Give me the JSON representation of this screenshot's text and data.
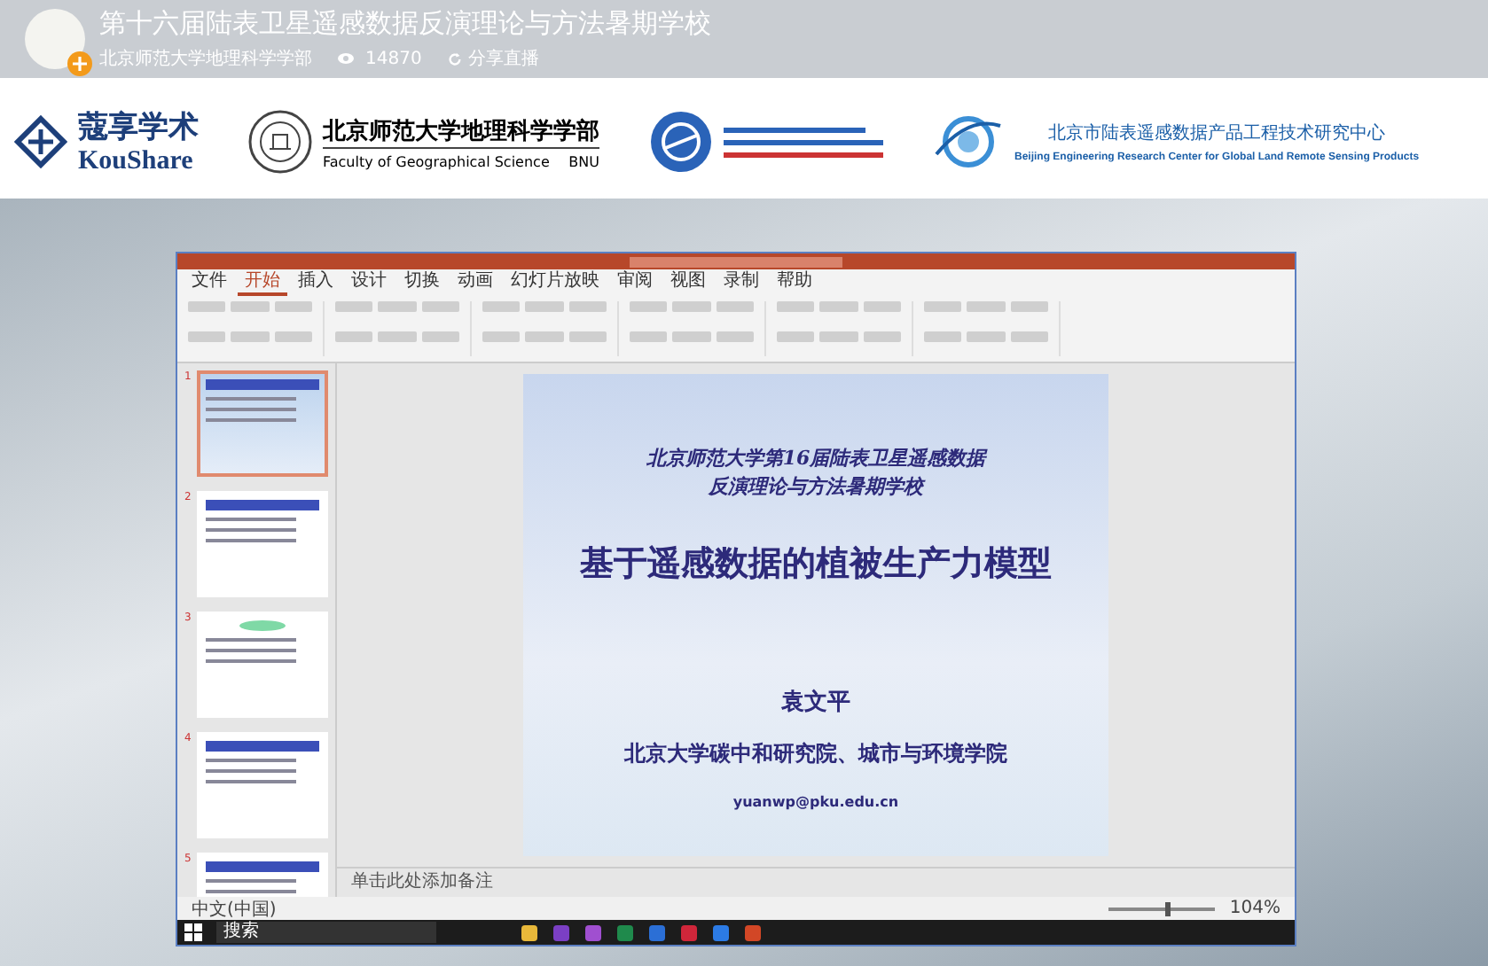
{
  "header": {
    "title": "第十六届陆表卫星遥感数据反演理论与方法暑期学校",
    "organizer": "北京师范大学地理科学学部",
    "views": "14870",
    "share": "分享直播"
  },
  "logos": {
    "koushare_cn": "蔻享学术",
    "koushare_en": "KouShare",
    "faculty_cn": "北京师范大学地理科学学部",
    "faculty_en": "Faculty of Geographical Science",
    "faculty_abbr": "BNU",
    "center_cn": "北京市陆表遥感数据产品工程技术研究中心",
    "center_en": "Beijing Engineering Research Center for Global Land Remote Sensing Products"
  },
  "ppt": {
    "tabs": [
      {
        "label": "文件",
        "selected": false
      },
      {
        "label": "开始",
        "selected": true
      },
      {
        "label": "插入",
        "selected": false
      },
      {
        "label": "设计",
        "selected": false
      },
      {
        "label": "切换",
        "selected": false
      },
      {
        "label": "动画",
        "selected": false
      },
      {
        "label": "幻灯片放映",
        "selected": false
      },
      {
        "label": "审阅",
        "selected": false
      },
      {
        "label": "视图",
        "selected": false
      },
      {
        "label": "录制",
        "selected": false
      },
      {
        "label": "帮助",
        "selected": false
      }
    ],
    "thumbnails": [
      {
        "number": "1",
        "selected": true
      },
      {
        "number": "2",
        "selected": false
      },
      {
        "number": "3",
        "selected": false
      },
      {
        "number": "4",
        "selected": false
      },
      {
        "number": "5",
        "selected": false
      }
    ],
    "slide": {
      "school": "北京师范大学第16届陆表卫星遥感数据反演理论与方法暑期学校",
      "title": "基于遥感数据的植被生产力模型",
      "author": "袁文平",
      "affiliation": "北京大学碳中和研究院、城市与环境学院",
      "email": "yuanwp@pku.edu.cn"
    },
    "notes_placeholder": "单击此处添加备注",
    "language": "中文(中国)",
    "zoom": "104%",
    "zoom_slider": {
      "level": 0.55
    },
    "taskbar_search": "搜索"
  }
}
